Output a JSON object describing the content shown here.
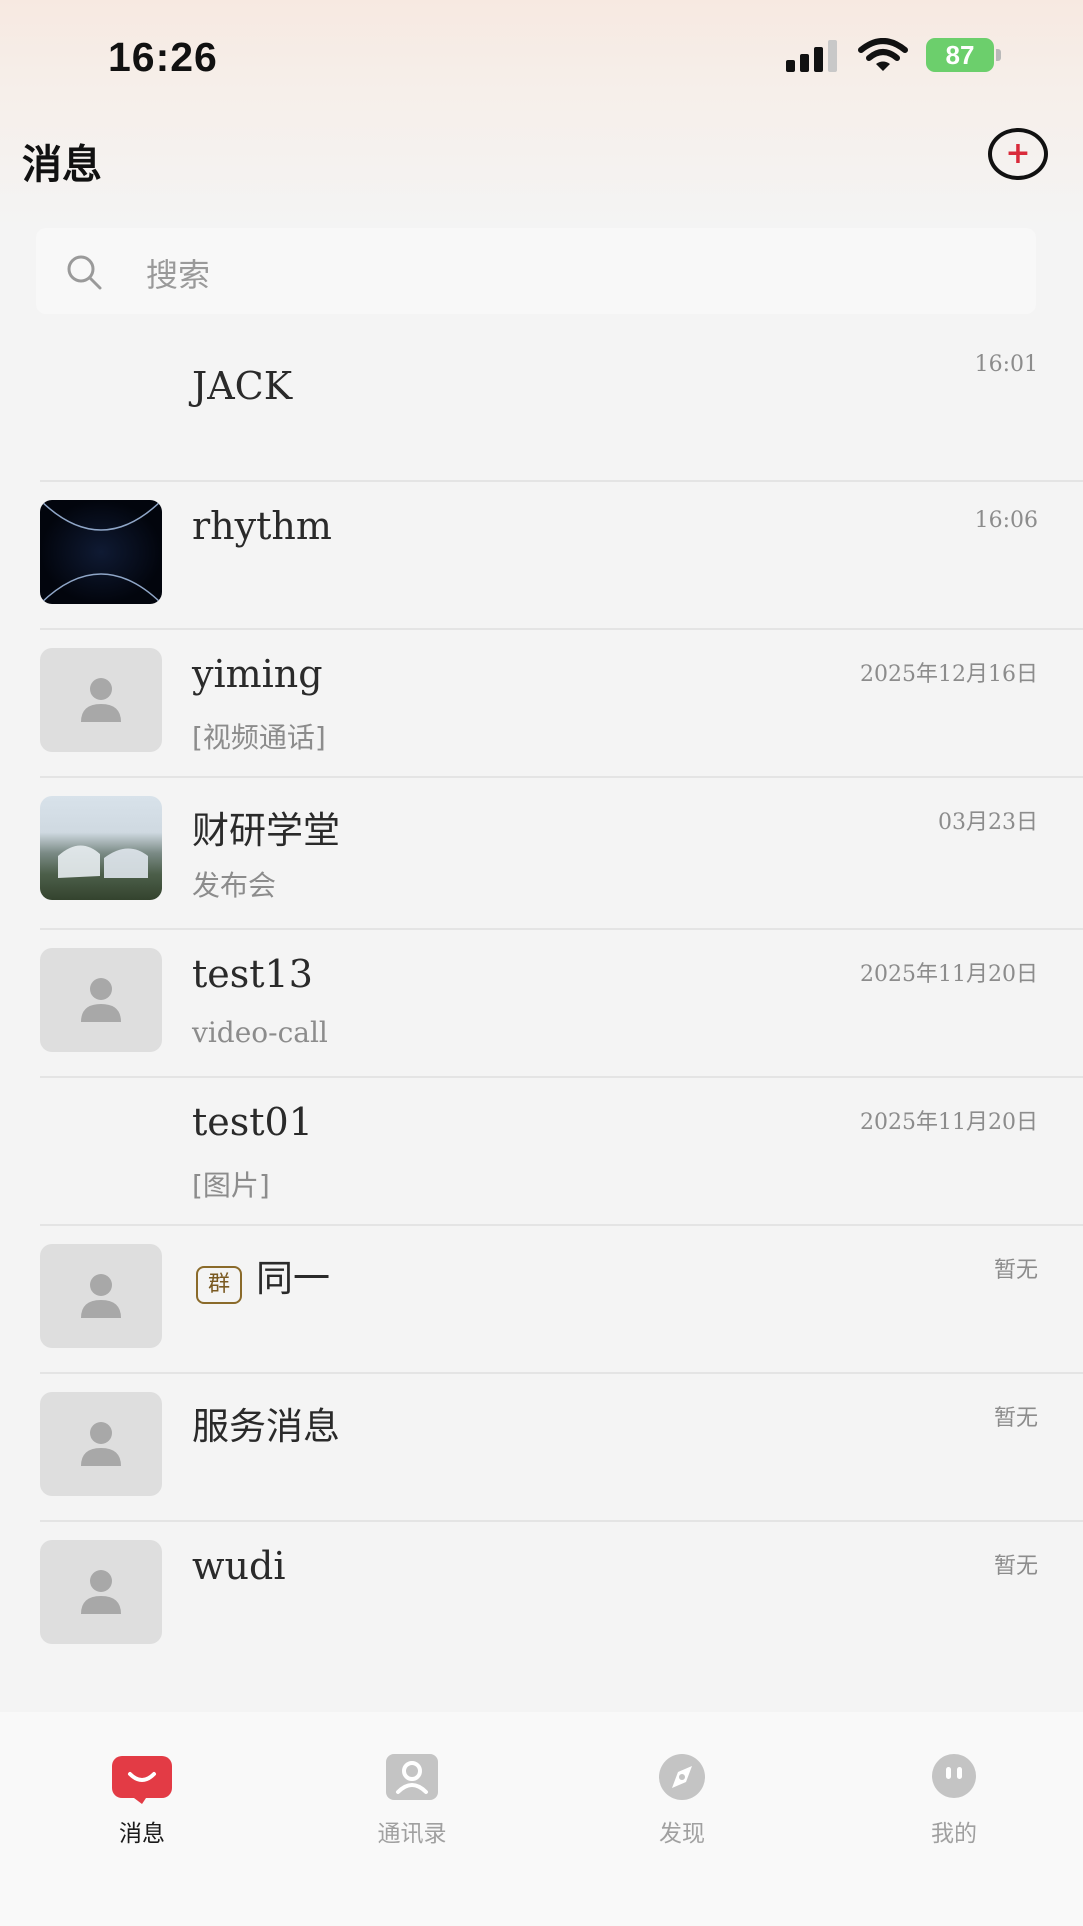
{
  "status_bar": {
    "time": "16:26",
    "battery": "87"
  },
  "header": {
    "title": "消息",
    "add_button_icon": "plus-circle-icon"
  },
  "search": {
    "placeholder": "搜索",
    "icon": "search-icon"
  },
  "chats": [
    {
      "name": "JACK",
      "preview": "",
      "time": "16:01",
      "avatar": "none"
    },
    {
      "name": "rhythm",
      "preview": "",
      "time": "16:06",
      "avatar": "dark-abstract"
    },
    {
      "name": "yiming",
      "preview": "[视频通话]",
      "time": "2025年12月16日",
      "avatar": "default-person"
    },
    {
      "name": "财研学堂",
      "preview": "发布会",
      "time": "03月23日",
      "avatar": "building-photo"
    },
    {
      "name": "test13",
      "preview": "video-call",
      "time": "2025年11月20日",
      "avatar": "default-person"
    },
    {
      "name": "test01",
      "preview": "[图片]",
      "time": "2025年11月20日",
      "avatar": "none"
    },
    {
      "name": "同一",
      "badge": "群",
      "preview": "",
      "time": "暂无",
      "avatar": "default-person"
    },
    {
      "name": "服务消息",
      "preview": "",
      "time": "暂无",
      "avatar": "default-person"
    },
    {
      "name": "wudi",
      "preview": "",
      "time": "暂无",
      "avatar": "default-person"
    }
  ],
  "tabs": [
    {
      "label": "消息",
      "icon": "chat-bubble-icon",
      "active": true
    },
    {
      "label": "通讯录",
      "icon": "contacts-icon",
      "active": false
    },
    {
      "label": "发现",
      "icon": "compass-icon",
      "active": false
    },
    {
      "label": "我的",
      "icon": "profile-icon",
      "active": false
    }
  ],
  "colors": {
    "accent": "#e33b45",
    "battery": "#6ccf6c",
    "badge_border": "#8a6a2a"
  }
}
